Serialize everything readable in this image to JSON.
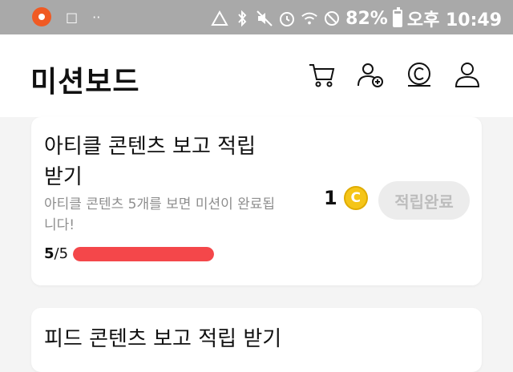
{
  "status_bar": {
    "battery_percent": "82%",
    "time": "오후 10:49",
    "battery_level": 0.82,
    "icons": [
      "screen-record-icon",
      "square-icon",
      "dots-icon",
      "data-saver-icon",
      "bluetooth-icon",
      "mute-icon",
      "alarm-icon",
      "wifi-icon",
      "do-not-disturb-icon",
      "battery-icon"
    ]
  },
  "header": {
    "title": "미션보드",
    "icons": [
      "cart-icon",
      "add-friend-icon",
      "coin-history-icon",
      "profile-icon"
    ]
  },
  "missions": [
    {
      "title_line1": "아티클 콘텐츠 보고 적립",
      "title_line2": "받기",
      "description": "아티클 콘텐츠 5개를 보면 미션이 완료됩니다!",
      "progress_count": "5",
      "progress_total": "/5",
      "progress_fraction": 1.0,
      "reward_amount": "1",
      "coin_symbol": "C",
      "claim_label": "적립완료"
    },
    {
      "title_line1": "피드 콘텐츠 보고 적립 받기"
    }
  ],
  "colors": {
    "status_bar_bg": "#a9a9a9",
    "progress_fill": "#f4474a",
    "coin": "#f5c518",
    "record_dot": "#f05a23"
  }
}
